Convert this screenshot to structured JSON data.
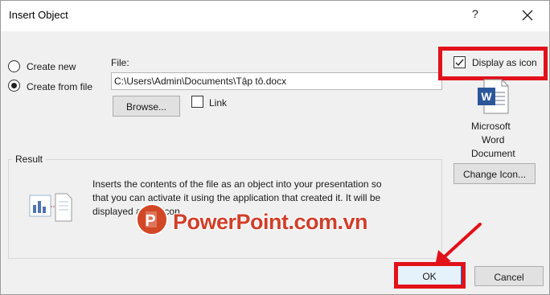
{
  "dialog": {
    "title": "Insert Object",
    "help_label": "?",
    "close_label": "✕"
  },
  "options": {
    "create_new": "Create new",
    "create_from_file": "Create from file",
    "selected": "create_from_file"
  },
  "file": {
    "label": "File:",
    "path": "C:\\Users\\Admin\\Documents\\Tập tô.docx",
    "browse_label": "Browse...",
    "link_label": "Link",
    "link_checked": false
  },
  "display_as_icon": {
    "label": "Display as icon",
    "checked": true
  },
  "icon_preview": {
    "caption_line1": "Microsoft",
    "caption_line2": "Word",
    "caption_line3": "Document",
    "change_icon_label": "Change Icon..."
  },
  "result": {
    "label": "Result",
    "line1": "Inserts the contents of the file as an object into your presentation so",
    "line2": "that you can activate it using the application that created it. It will be",
    "line3": "displayed as an icon."
  },
  "footer": {
    "ok_label": "OK",
    "cancel_label": "Cancel"
  },
  "watermark": {
    "text": "PowerPoint.com.vn"
  },
  "colors": {
    "highlight_red": "#e2111a",
    "word_blue": "#2b579a",
    "watermark_orange": "#d23e2a"
  }
}
